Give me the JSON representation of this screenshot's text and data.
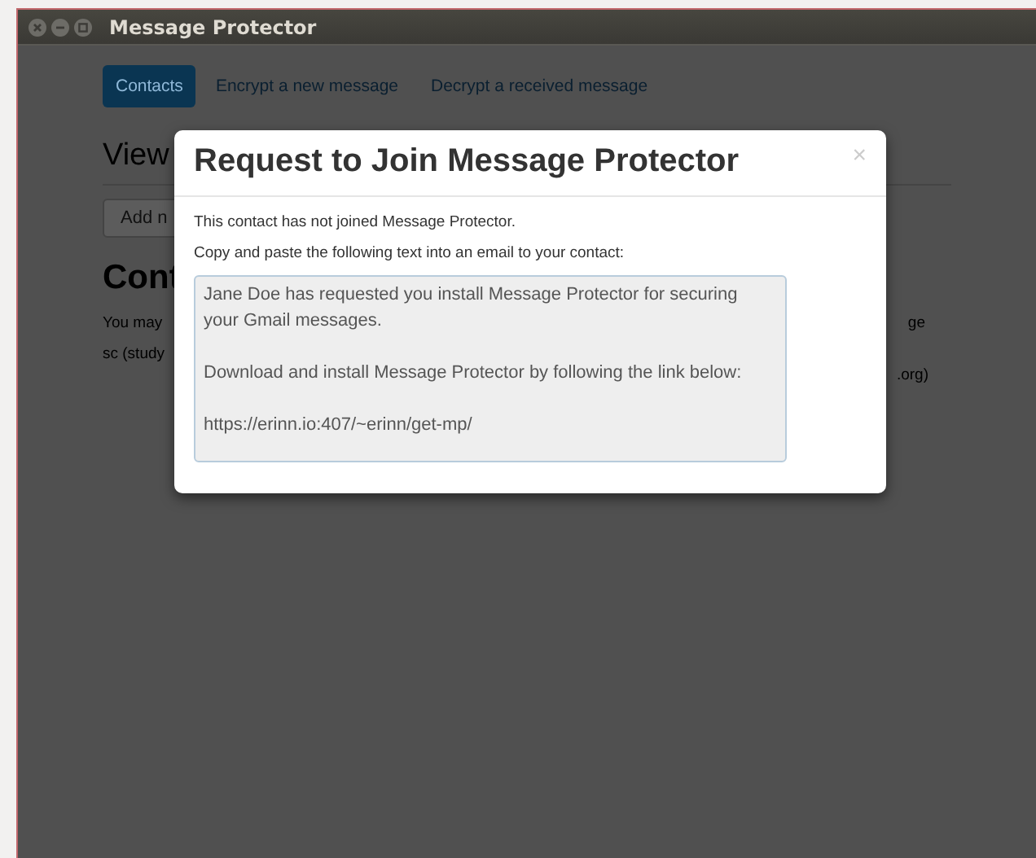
{
  "window": {
    "title": "Message Protector"
  },
  "nav": [
    {
      "label": "Contacts",
      "selected": true
    },
    {
      "label": "Encrypt a new message",
      "selected": false
    },
    {
      "label": "Decrypt a received message",
      "selected": false
    }
  ],
  "page": {
    "heading": "View",
    "add_button": "Add n",
    "section_heading": "Cont",
    "paragraph_lines": [
      {
        "left": "You may",
        "right": "ge"
      },
      {
        "left": "sc (study",
        "right": ".org)"
      }
    ]
  },
  "modal": {
    "title": "Request to Join Message Protector",
    "close": "×",
    "lines": [
      "This contact has not joined Message Protector.",
      "Copy and paste the following text into an email to your contact:"
    ],
    "message": {
      "value": "Jane Doe has requested you install Message Protector for securing your Gmail messages.\n\nDownload and install Message Protector by following the link below:\n\nhttps://erinn.io:407/~erinn/get-mp/"
    }
  }
}
